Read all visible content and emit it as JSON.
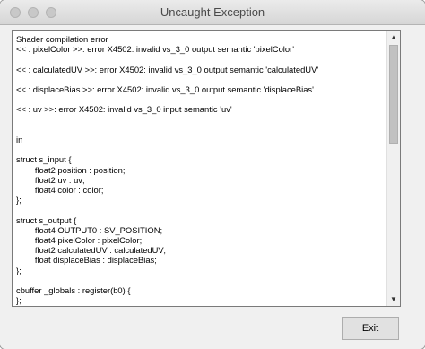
{
  "window": {
    "title": "Uncaught Exception"
  },
  "error_text": "Shader compilation error\n<< : pixelColor >>: error X4502: invalid vs_3_0 output semantic 'pixelColor'\n\n<< : calculatedUV >>: error X4502: invalid vs_3_0 output semantic 'calculatedUV'\n\n<< : displaceBias >>: error X4502: invalid vs_3_0 output semantic 'displaceBias'\n\n<< : uv >>: error X4502: invalid vs_3_0 input semantic 'uv'\n\n\nin\n\nstruct s_input {\n\tfloat2 position : position;\n\tfloat2 uv : uv;\n\tfloat4 color : color;\n};\n\nstruct s_output {\n\tfloat4 OUTPUT0 : SV_POSITION;\n\tfloat4 pixelColor : pixelColor;\n\tfloat2 calculatedUV : calculatedUV;\n\tfloat displaceBias : displaceBias;\n};\n\ncbuffer _globals : register(b0) {\n};",
  "buttons": {
    "exit_label": "Exit"
  },
  "scrollbar": {
    "up_icon": "▲",
    "down_icon": "▼"
  }
}
